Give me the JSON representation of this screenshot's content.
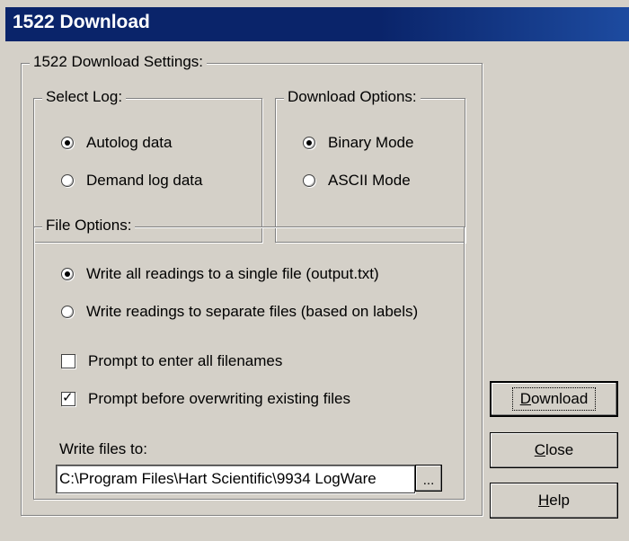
{
  "window": {
    "title": "1522 Download"
  },
  "settings_group": {
    "legend": "1522 Download Settings:"
  },
  "select_log": {
    "legend": "Select Log:",
    "options": [
      {
        "label": "Autolog data",
        "selected": true
      },
      {
        "label": "Demand log data",
        "selected": false
      }
    ]
  },
  "download_options": {
    "legend": "Download Options:",
    "options": [
      {
        "label": "Binary Mode",
        "selected": true
      },
      {
        "label": "ASCII Mode",
        "selected": false
      }
    ]
  },
  "file_options": {
    "legend": "File Options:",
    "radios": [
      {
        "label": "Write all readings to a single file (output.txt)",
        "selected": true
      },
      {
        "label": "Write readings to separate files (based on labels)",
        "selected": false
      }
    ],
    "checkboxes": [
      {
        "label": "Prompt to enter all filenames",
        "checked": false
      },
      {
        "label": "Prompt before overwriting existing files",
        "checked": true
      }
    ],
    "write_files_label": "Write files to:",
    "path_value": "C:\\Program Files\\Hart Scientific\\9934 LogWare",
    "browse_label": "..."
  },
  "buttons": {
    "download": {
      "prefix": "",
      "accel": "D",
      "rest": "ownload"
    },
    "close": {
      "prefix": "",
      "accel": "C",
      "rest": "lose"
    },
    "help": {
      "prefix": "",
      "accel": "H",
      "rest": "elp"
    }
  }
}
